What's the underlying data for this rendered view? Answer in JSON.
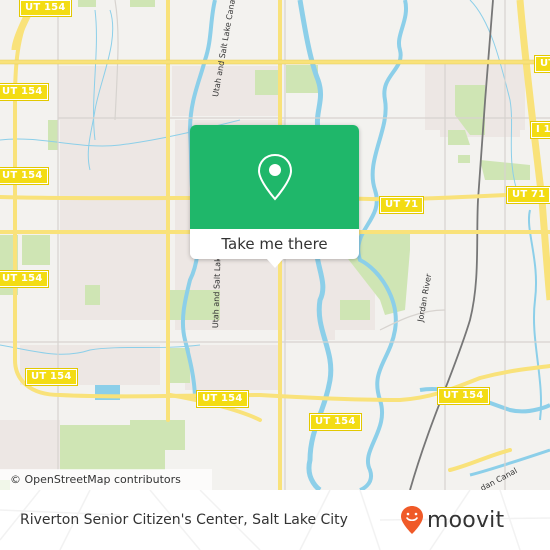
{
  "map": {
    "shields": [
      {
        "label": "UT 154"
      },
      {
        "label": "UT 154"
      },
      {
        "label": "UT 154"
      },
      {
        "label": "UT 154"
      },
      {
        "label": "UT 154"
      },
      {
        "label": "UT 154"
      },
      {
        "label": "UT 154"
      },
      {
        "label": "UT 154"
      },
      {
        "label": "UT 154"
      },
      {
        "label": "UT 71"
      },
      {
        "label": "UT 71"
      },
      {
        "label": "UT"
      },
      {
        "label": "I 1"
      }
    ],
    "road_labels": {
      "canal_north": "Utah and Salt Lake Canal",
      "canal_south": "Utah and Salt Lake",
      "jordan_river": "Jordan River",
      "jordan_canal": "dan Canal"
    },
    "attribution": "© OpenStreetMap contributors",
    "colors": {
      "background": "#f3f2ef",
      "residential": "#ede7e4",
      "park": "#cfe5b4",
      "water": "#8ccfe9",
      "major_road": "#f9e27a",
      "minor_road": "#d7d3cf",
      "rail": "#777777"
    }
  },
  "popup": {
    "icon": "map-pin-icon",
    "action_label": "Take me there",
    "accent_color": "#1fb76a"
  },
  "footer": {
    "place_name": "Riverton Senior Citizen's Center, Salt Lake City",
    "logo_text": "moovit",
    "logo_color": "#f05a28"
  }
}
